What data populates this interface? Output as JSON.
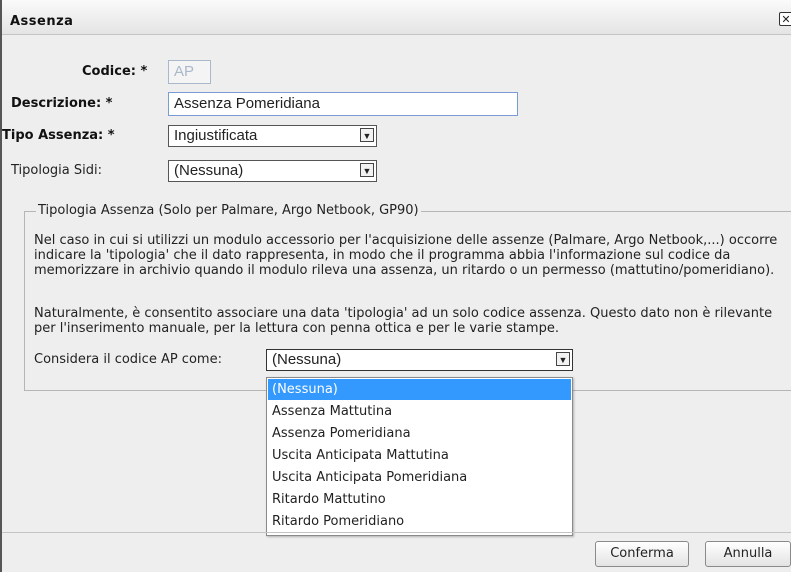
{
  "window": {
    "title": "Assenza",
    "close_icon": "close-icon"
  },
  "form": {
    "codice": {
      "label": "Codice: *",
      "value": "AP"
    },
    "descrizione": {
      "label": "Descrizione: *",
      "value": "Assenza Pomeridiana"
    },
    "tipo_assenza": {
      "label": "Tipo Assenza: *",
      "value": "Ingiustificata"
    },
    "tipologia_sidi": {
      "label": "Tipologia Sidi:",
      "value": "(Nessuna)"
    }
  },
  "fieldset": {
    "legend": "Tipologia Assenza (Solo per Palmare, Argo Netbook, GP90)",
    "paragraph1": "Nel caso in cui si utilizzi un modulo accessorio per l'acquisizione delle assenze (Palmare, Argo Netbook,...) occorre indicare la 'tipologia' che il dato rappresenta, in modo che il programma abbia l'informazione sul codice da memorizzare in archivio quando il modulo rileva una assenza, un ritardo o un permesso (mattutino/pomeridiano).",
    "paragraph2": "Naturalmente, è consentito associare una data 'tipologia' ad un solo codice assenza. Questo dato non è rilevante per l'inserimento manuale, per la lettura con penna ottica e per le varie stampe.",
    "considera_label": "Considera il codice AP come:",
    "considera_value": "(Nessuna)",
    "options": [
      "(Nessuna)",
      "Assenza Mattutina",
      "Assenza Pomeridiana",
      "Uscita Anticipata Mattutina",
      "Uscita Anticipata Pomeridiana",
      "Ritardo Mattutino",
      "Ritardo Pomeridiano"
    ],
    "selected_option": "(Nessuna)"
  },
  "buttons": {
    "confirm": "Conferma",
    "cancel": "Annulla"
  },
  "colors": {
    "selection": "#3399ff",
    "input_border": "#7a9cd3",
    "dialog_bg": "#eeeeee"
  }
}
